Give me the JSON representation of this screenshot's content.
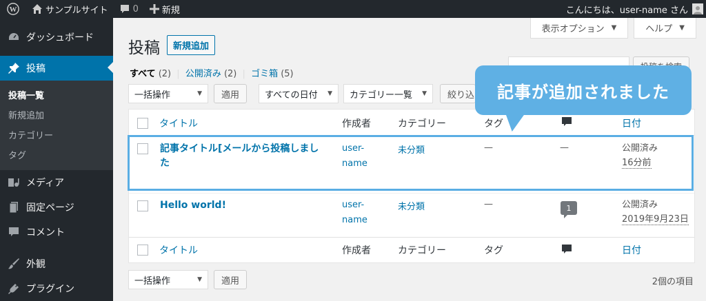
{
  "adminbar": {
    "site_name": "サンプルサイト",
    "comment_count": "0",
    "new_label": "新規",
    "greeting": "こんにちは、user-name さん"
  },
  "sidebar": {
    "dashboard": "ダッシュボード",
    "posts": "投稿",
    "submenu": [
      "投稿一覧",
      "新規追加",
      "カテゴリー",
      "タグ"
    ],
    "media": "メディア",
    "pages": "固定ページ",
    "comments": "コメント",
    "appearance": "外観",
    "plugins": "プラグイン"
  },
  "screen_tabs": {
    "options": "表示オプション",
    "help": "ヘルプ"
  },
  "header": {
    "title": "投稿",
    "add_new": "新規追加"
  },
  "search": {
    "button": "投稿を検索"
  },
  "filters": {
    "all": "すべて",
    "all_count": "(2)",
    "published": "公開済み",
    "published_count": "(2)",
    "trash": "ゴミ箱",
    "trash_count": "(5)",
    "separator": "|"
  },
  "toolbar": {
    "bulk_action": "一括操作",
    "apply": "適用",
    "all_dates": "すべての日付",
    "category_list": "カテゴリー一覧",
    "filter": "絞り込"
  },
  "table": {
    "columns": {
      "title": "タイトル",
      "author": "作成者",
      "categories": "カテゴリー",
      "tags": "タグ",
      "date": "日付"
    },
    "rows": [
      {
        "title_line1": "記事タイトル[メールから投稿しまし",
        "title_line2": "た",
        "author_line1": "user-",
        "author_line2": "name",
        "category": "未分類",
        "tags": "—",
        "comments": "—",
        "status": "公開済み",
        "date": "16分前"
      },
      {
        "title_line1": "Hello world!",
        "author_line1": "user-",
        "author_line2": "name",
        "category": "未分類",
        "tags": "—",
        "comments": "1",
        "status": "公開済み",
        "date": "2019年9月23日"
      }
    ]
  },
  "footer": {
    "bulk_action": "一括操作",
    "apply": "適用",
    "items_count": "2個の項目"
  },
  "callout": {
    "text": "記事が追加されました"
  },
  "colors": {
    "admin_dark": "#23282d",
    "accent": "#0073aa",
    "callout": "#5fb0e4"
  }
}
